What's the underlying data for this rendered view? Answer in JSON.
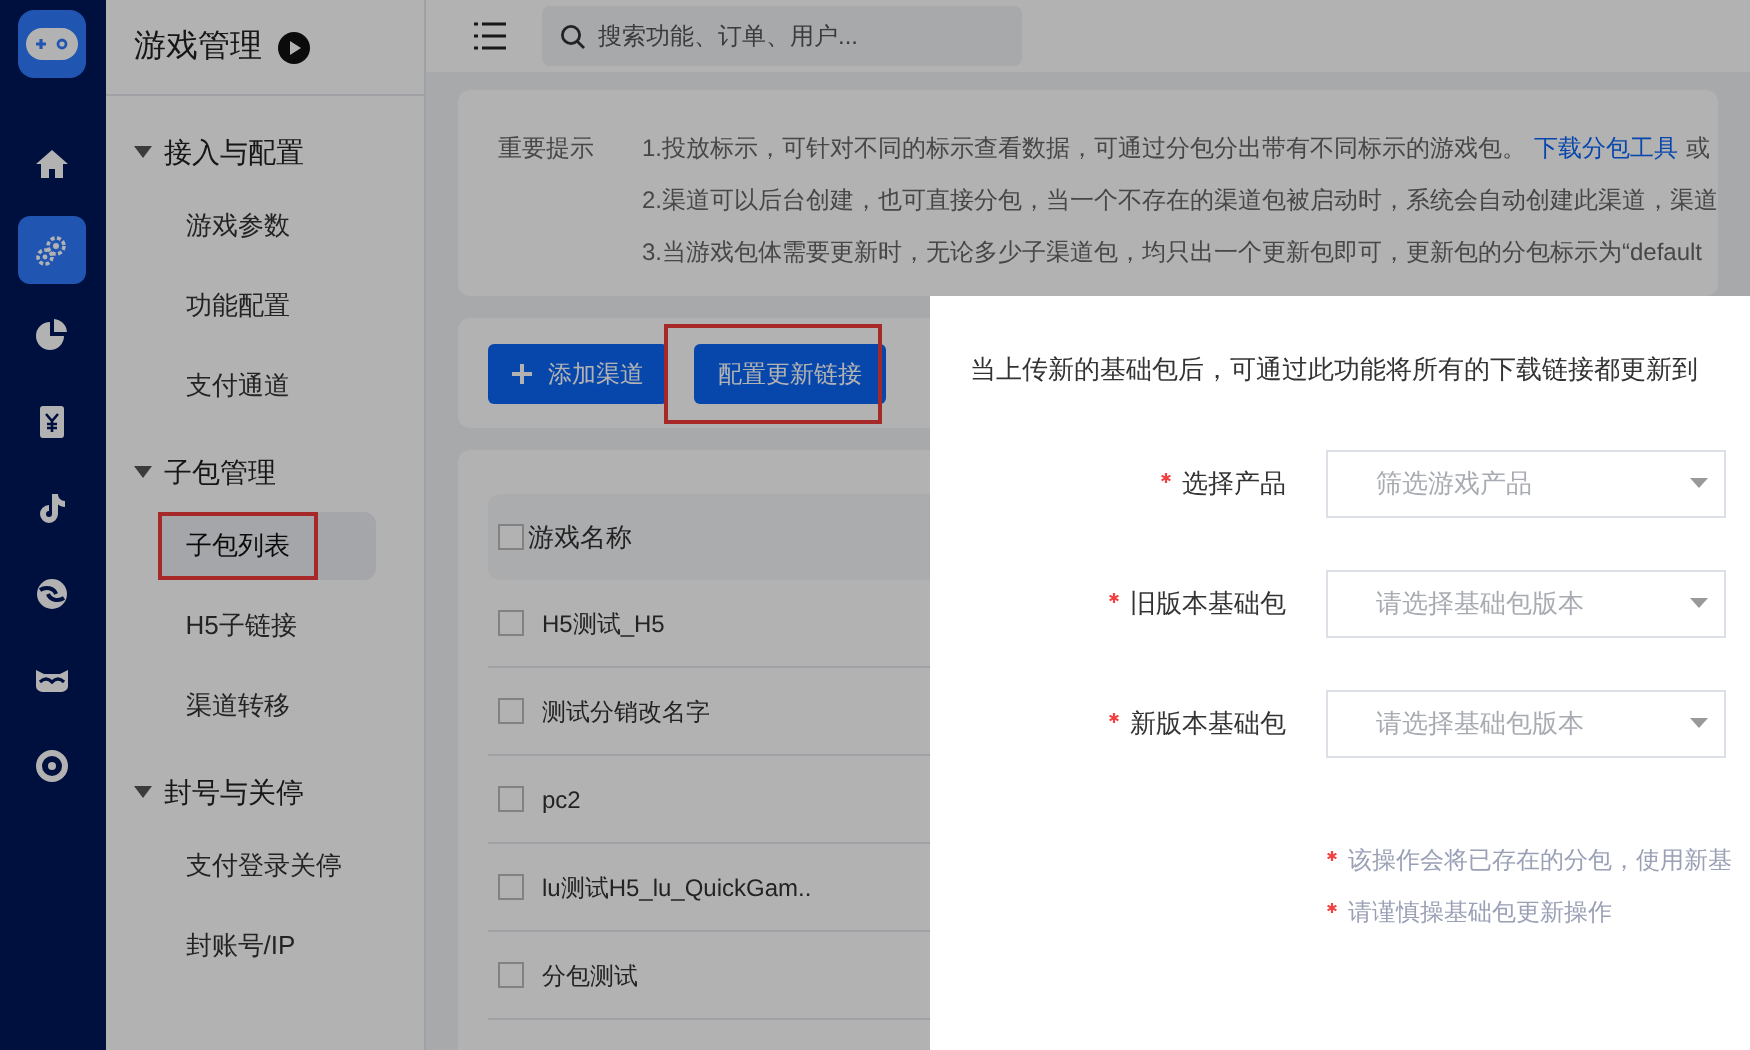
{
  "rail": {
    "items": [
      {
        "selected": false
      },
      {
        "selected": true
      },
      {
        "selected": false
      },
      {
        "selected": false
      },
      {
        "selected": false
      },
      {
        "selected": false
      },
      {
        "selected": false
      },
      {
        "selected": false
      }
    ]
  },
  "sidebar": {
    "title": "游戏管理",
    "groups": [
      {
        "label": "接入与配置",
        "expanded": true,
        "items": [
          {
            "label": "游戏参数",
            "selected": false,
            "annotated": false
          },
          {
            "label": "功能配置",
            "selected": false,
            "annotated": false
          },
          {
            "label": "支付通道",
            "selected": false,
            "annotated": false
          }
        ]
      },
      {
        "label": "子包管理",
        "expanded": true,
        "items": [
          {
            "label": "子包列表",
            "selected": true,
            "annotated": true
          },
          {
            "label": "H5子链接",
            "selected": false,
            "annotated": false
          },
          {
            "label": "渠道转移",
            "selected": false,
            "annotated": false
          }
        ]
      },
      {
        "label": "封号与关停",
        "expanded": true,
        "items": [
          {
            "label": "支付登录关停",
            "selected": false,
            "annotated": false
          },
          {
            "label": "封账号/IP",
            "selected": false,
            "annotated": false
          }
        ]
      }
    ]
  },
  "topbar": {
    "search": {
      "placeholder": "搜索功能、订单、用户..."
    }
  },
  "notice": {
    "label": "重要提示",
    "lines": [
      {
        "text": "1.投放标示，可针对不同的标示查看数据，可通过分包分出带有不同标示的游戏包。",
        "link": "下载分包工具",
        "after": "或"
      },
      {
        "text": "2.渠道可以后台创建，也可直接分包，当一个不存在的渠道包被启动时，系统会自动创建此渠道，渠道"
      },
      {
        "text": "3.当游戏包体需要更新时，无论多少子渠道包，均只出一个更新包即可，更新包的分包标示为“default"
      }
    ]
  },
  "actions": [
    {
      "label": "添加渠道",
      "kind": "add",
      "annotated": false
    },
    {
      "label": "配置更新链接",
      "kind": "plain",
      "annotated": true
    }
  ],
  "table": {
    "select_all": {
      "checked": false
    },
    "columns": [
      "游戏名称"
    ],
    "rows": [
      {
        "name": "H5测试_H5",
        "checked": false
      },
      {
        "name": "测试分销改名字",
        "checked": false
      },
      {
        "name": "pc2",
        "checked": false
      },
      {
        "name": "lu测试H5_lu_QuickGam..",
        "checked": false
      },
      {
        "name": "分包测试",
        "checked": false
      }
    ]
  },
  "drawer": {
    "intro": "当上传新的基础包后，可通过此功能将所有的下载链接都更新到",
    "fields": [
      {
        "label": "选择产品",
        "required": true,
        "placeholder": "筛选游戏产品"
      },
      {
        "label": "旧版本基础包",
        "required": true,
        "placeholder": "请选择基础包版本"
      },
      {
        "label": "新版本基础包",
        "required": true,
        "placeholder": "请选择基础包版本"
      }
    ],
    "notes": [
      "该操作会将已存在的分包，使用新基",
      "请谨慎操基础包更新操作"
    ]
  }
}
